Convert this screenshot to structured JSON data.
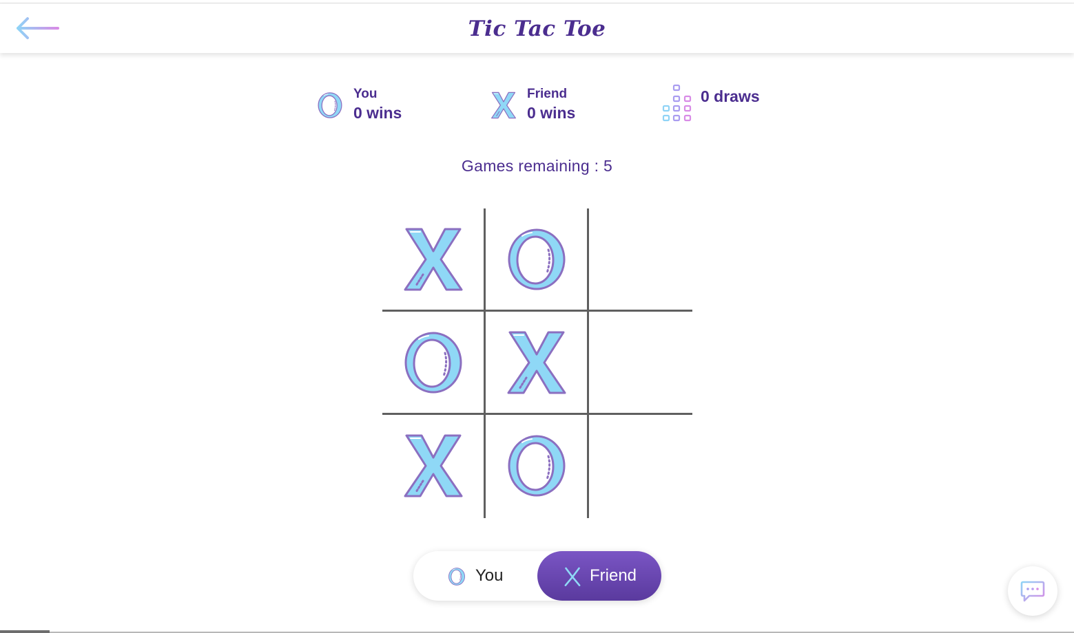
{
  "header": {
    "title": "Tic Tac Toe",
    "back_icon": "arrow-left-icon"
  },
  "scoreboard": {
    "you": {
      "label": "You",
      "wins": "0 wins",
      "icon": "o-mark-icon"
    },
    "friend": {
      "label": "Friend",
      "wins": "0 wins",
      "icon": "x-mark-icon"
    },
    "draws": {
      "text": "0 draws",
      "icon": "draws-blocks-icon"
    }
  },
  "games_remaining": "Games remaining : 5",
  "board": {
    "cells": [
      "X",
      "O",
      "",
      "O",
      "X",
      "",
      "X",
      "O",
      ""
    ]
  },
  "turn_toggle": {
    "you_label": "You",
    "friend_label": "Friend",
    "active": "Friend"
  },
  "chat_icon": "chat-bubble-icon",
  "colors": {
    "title": "#4b2d8f",
    "mark_fill": "#8fd8f6",
    "mark_stroke": "#8b6fc0",
    "toggle_active": "#6a48b4",
    "grid_line": "#5f5f5f"
  }
}
